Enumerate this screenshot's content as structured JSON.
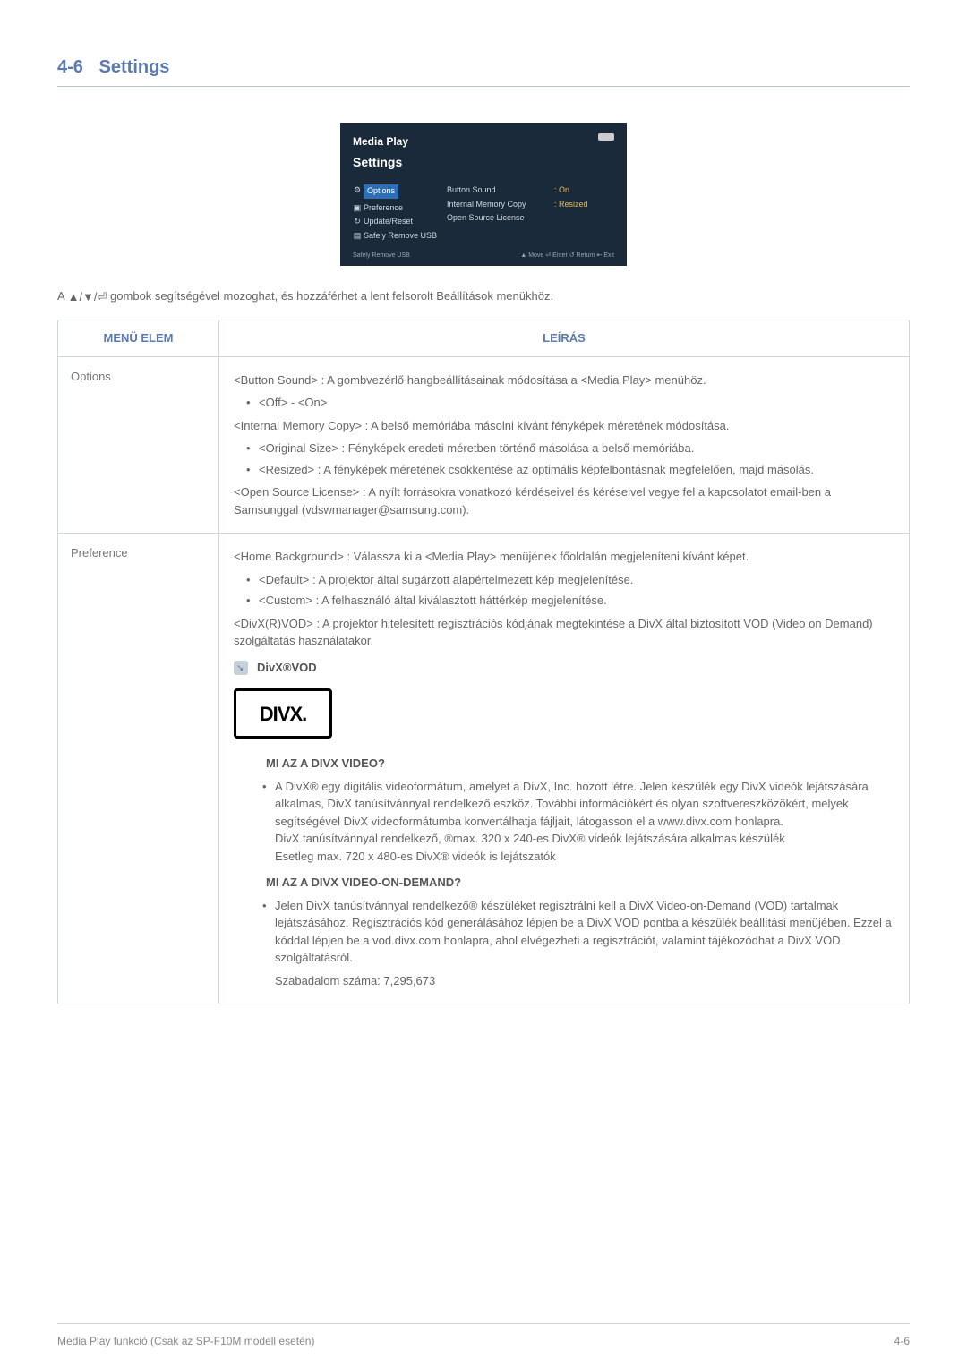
{
  "section": {
    "number": "4-6",
    "title": "Settings"
  },
  "screenshot": {
    "title": "Media Play",
    "subtitle": "Settings",
    "left_items": [
      "Options",
      "Preference",
      "Update/Reset",
      "Safely Remove USB"
    ],
    "mid_items": [
      "Button Sound",
      "Internal Memory Copy",
      "Open Source License"
    ],
    "right_items": [
      ": On",
      ": Resized"
    ],
    "foot_left": "Safely Remove USB",
    "foot_right": "▲ Move   ⏎ Enter   ↺ Return   ⇤ Exit"
  },
  "intro_before": "A ",
  "nav_glyphs": "▲/▼/⏎",
  "intro_after": " gombok segítségével mozoghat, és hozzáférhet a lent felsorolt Beállítások menükhöz.",
  "table": {
    "head_left": "MENÜ ELEM",
    "head_right": "LEÍRÁS",
    "row1": {
      "left": "Options",
      "button_sound": "<Button Sound> : A gombvezérlő hangbeállításainak módosítása a <Media Play> menühöz.",
      "off_on": "<Off> - <On>",
      "imc": "<Internal Memory Copy> : A belső memóriába másolni kívánt fényképek méretének módosítása.",
      "original": "<Original Size> : Fényképek eredeti méretben történő másolása a belső memóriába.",
      "resized": "<Resized> : A fényképek méretének csökkentése az optimális képfelbontásnak megfelelően, majd másolás.",
      "osl": "<Open Source License> : A nyílt forrásokra vonatkozó kérdéseivel és kéréseivel vegye fel a kapcsolatot email-ben a Samsunggal (vdswmanager@samsung.com)."
    },
    "row2": {
      "left": "Preference",
      "home_bg": "<Home Background> : Válassza ki a <Media Play> menüjének főoldalán megjeleníteni kívánt képet.",
      "default_opt": "<Default> : A projektor által sugárzott alapértelmezett kép megjelenítése.",
      "custom_opt": "<Custom> : A felhasználó által kiválasztott háttérkép megjelenítése.",
      "divx_vod": "<DivX(R)VOD> : A projektor hitelesített regisztrációs kódjának megtekintése a DivX által biztosított VOD (Video on Demand) szolgáltatás használatakor.",
      "divx_note": "DivX®VOD",
      "divx_logo": "DIVX.",
      "h1": "MI AZ A DIVX VIDEO?",
      "p1": "A DivX® egy digitális videoformátum, amelyet a DivX, Inc. hozott létre. Jelen készülék egy DivX videók lejátszására alkalmas, DivX tanúsítvánnyal rendelkező eszköz. További információkért és olyan szoftvereszközökért, melyek segítségével DivX videoformátumba konvertálhatja fájljait, látogasson el a www.divx.com honlapra.",
      "p1b": "DivX tanúsítvánnyal rendelkező, ®max. 320 x 240-es DivX® videók lejátszására alkalmas készülék",
      "p1c": "Esetleg max. 720 x 480-es DivX® videók is lejátszatók",
      "h2": "MI AZ A DIVX VIDEO-ON-DEMAND?",
      "p2": "Jelen DivX tanúsítvánnyal rendelkező® készüléket regisztrálni kell a DivX Video-on-Demand (VOD) tartalmak lejátszásához. Regisztrációs kód generálásához lépjen be a DivX VOD pontba a készülék beállítási menüjében. Ezzel a kóddal lépjen be a vod.divx.com honlapra, ahol elvégezheti a regisztrációt, valamint tájékozódhat a DivX VOD szolgáltatásról.",
      "patent": "Szabadalom száma: 7,295,673"
    }
  },
  "footer": {
    "left": "Media Play funkció (Csak az SP-F10M modell esetén)",
    "right": "4-6"
  }
}
